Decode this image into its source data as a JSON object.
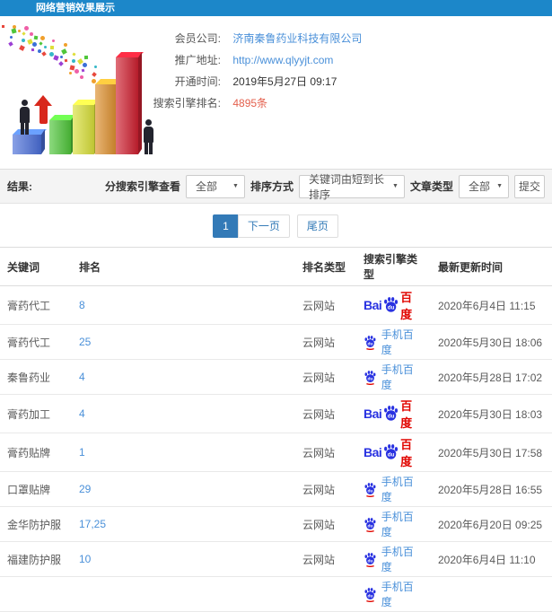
{
  "app": {
    "title": "网络营销效果展示"
  },
  "info": {
    "rows": [
      {
        "label": "会员公司:",
        "value": "济南秦鲁药业科技有限公司"
      },
      {
        "label": "推广地址:",
        "value": "http://www.qlyyjt.com"
      },
      {
        "label": "开通时间:",
        "value": "2019年5月27日 09:17"
      },
      {
        "label": "搜索引擎排名:",
        "value": "4895条"
      }
    ]
  },
  "filter": {
    "result_label": "结果:",
    "engine_view_label": "分搜索引擎查看",
    "engine_view_value": "全部",
    "sort_label": "排序方式",
    "sort_value": "关键词由短到长排序",
    "article_label": "文章类型",
    "article_value": "全部",
    "submit_label": "提交"
  },
  "pagination": {
    "current": "1",
    "next_label": "下一页",
    "last_label": "尾页"
  },
  "table": {
    "headers": [
      "关键词",
      "排名",
      "排名类型",
      "搜索引擎类型",
      "最新更新时间"
    ],
    "rows": [
      {
        "keyword": "膏药代工",
        "rank": "8",
        "rank_type": "云网站",
        "engine": "baidu_pc",
        "updated": "2020年6月4日 11:15"
      },
      {
        "keyword": "膏药代工",
        "rank": "25",
        "rank_type": "云网站",
        "engine": "baidu_mobile",
        "updated": "2020年5月30日 18:06"
      },
      {
        "keyword": "秦鲁药业",
        "rank": "4",
        "rank_type": "云网站",
        "engine": "baidu_mobile",
        "updated": "2020年5月28日 17:02"
      },
      {
        "keyword": "膏药加工",
        "rank": "4",
        "rank_type": "云网站",
        "engine": "baidu_pc",
        "updated": "2020年5月30日 18:03"
      },
      {
        "keyword": "膏药贴牌",
        "rank": "1",
        "rank_type": "云网站",
        "engine": "baidu_pc",
        "updated": "2020年5月30日 17:58"
      },
      {
        "keyword": "口罩贴牌",
        "rank": "29",
        "rank_type": "云网站",
        "engine": "baidu_mobile",
        "updated": "2020年5月28日 16:55"
      },
      {
        "keyword": "金华防护服",
        "rank": "17,25",
        "rank_type": "云网站",
        "engine": "baidu_mobile",
        "updated": "2020年6月20日 09:25"
      },
      {
        "keyword": "福建防护服",
        "rank": "10",
        "rank_type": "云网站",
        "engine": "baidu_mobile",
        "updated": "2020年6月4日 11:10"
      },
      {
        "keyword": "",
        "rank": "",
        "rank_type": "",
        "engine": "baidu_mobile",
        "updated": "",
        "partial": true
      }
    ]
  },
  "engines": {
    "pc": {
      "bai": "Bai",
      "du": "du",
      "hanzi": "百度"
    },
    "mobile": {
      "du": "du",
      "label": "手机百度"
    }
  },
  "colors": {
    "header_bg": "#1c87c9",
    "link_blue": "#4a90d9",
    "alert_red": "#e4604d",
    "pagination_blue": "#337ab7",
    "baidu_blue": "#2932e1",
    "baidu_red": "#e10601"
  },
  "illustration": {
    "bar_colors": [
      "#4a6fd9",
      "#4fc63a",
      "#d9e03a",
      "#dd8f2d",
      "#cf2030"
    ]
  }
}
